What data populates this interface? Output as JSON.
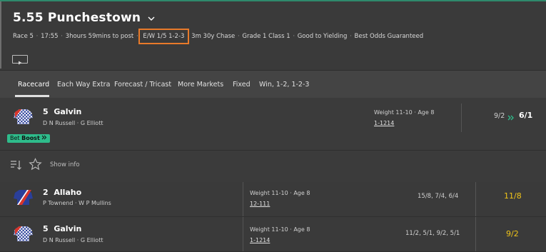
{
  "race": {
    "title": "5.55 Punchestown",
    "meta": {
      "race_no": "Race 5",
      "time": "17:55",
      "countdown": "3hours 59mins to post",
      "each_way": "E/W 1/5 1-2-3",
      "distance": "3m 30y Chase",
      "grade": "Grade 1 Class 1",
      "going": "Good to Yielding",
      "guarantee": "Best Odds Guaranteed"
    }
  },
  "tabs": [
    "Racecard",
    "Each Way Extra",
    "Forecast / Tricast",
    "More Markets",
    "Fixed",
    "Win, 1-2, 1-2-3"
  ],
  "selected_runner": {
    "number": "5",
    "name": "Galvin",
    "jockey": "D N Russell",
    "trainer": "G Elliott",
    "weight": "Weight 11-10",
    "age": "Age 8",
    "form": "1-1214",
    "odds_from": "9/2",
    "odds_to": "6/1",
    "boost_prefix": "Bet",
    "boost_label": "Boost"
  },
  "tools": {
    "show_info": "Show info"
  },
  "runners": [
    {
      "number": "2",
      "name": "Allaho",
      "jockey": "P Townend",
      "trainer": "W P Mullins",
      "weight": "Weight 11-10",
      "age": "Age 8",
      "form": "12-111",
      "prev_odds": "15/8, 7/4, 6/4",
      "odds": "11/8"
    },
    {
      "number": "5",
      "name": "Galvin",
      "jockey": "D N Russell",
      "trainer": "G Elliott",
      "weight": "Weight 11-10",
      "age": "Age 8",
      "form": "1-1214",
      "prev_odds": "11/2, 5/1, 9/2, 5/1",
      "odds": "9/2"
    }
  ],
  "colors": {
    "accent_green": "#2ebc8b",
    "odds_yellow": "#f0c419",
    "highlight_box": "#e87a2a"
  },
  "icons": [
    "chevron-down-icon",
    "play-icon",
    "double-chevron-right-icon",
    "sort-icon",
    "star-icon",
    "silk-icon"
  ]
}
